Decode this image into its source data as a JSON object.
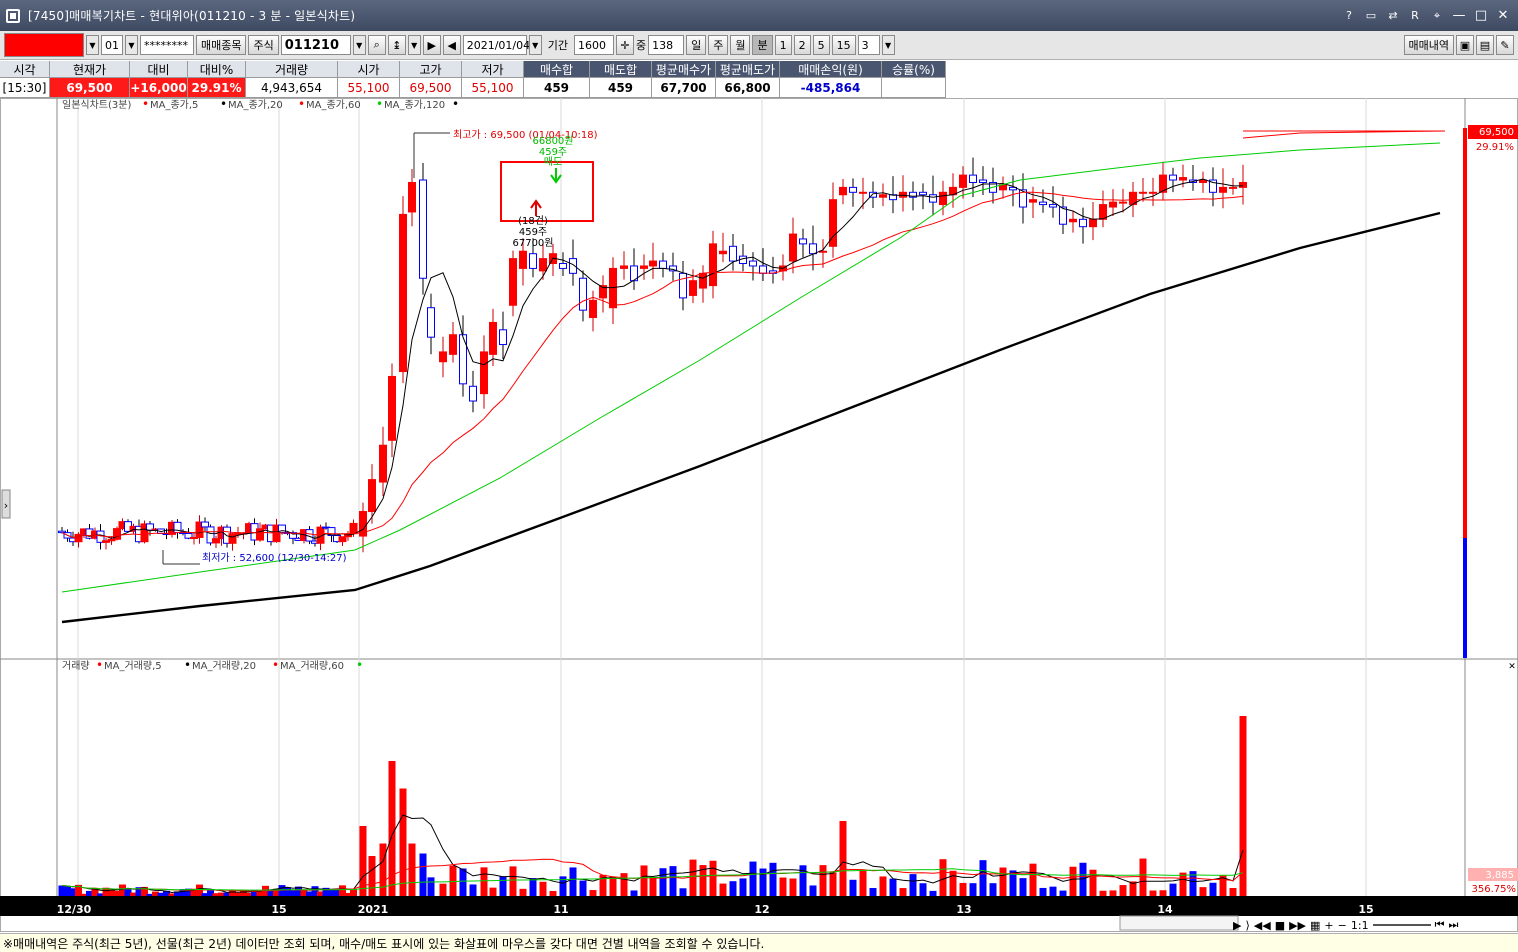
{
  "window": {
    "title": "[7450]매매복기차트 - 현대위아(011210 - 3 분 - 일본식차트)",
    "controls": {
      "help": "?",
      "restore_r": "R",
      "minimize": "—",
      "maximize": "□",
      "close": "✕"
    }
  },
  "toolbar": {
    "account_suffix": "01",
    "password": "********",
    "trade_items_btn": "매매종목",
    "stock_type": "주식",
    "stock_code": "011210",
    "date": "2021/01/04",
    "period_label": "기간",
    "period_value": "1600",
    "middle_label": "중",
    "middle_value": "138",
    "day": "일",
    "week": "주",
    "month": "월",
    "minute": "분",
    "n1": "1",
    "n2": "2",
    "n5": "5",
    "n15": "15",
    "interval": "3",
    "trade_history_btn": "매매내역"
  },
  "quote": {
    "headers": [
      "시각",
      "현재가",
      "대비",
      "대비%",
      "거래량",
      "시가",
      "고가",
      "저가",
      "매수합",
      "매도합",
      "평균매수가",
      "평균매도가",
      "매매손익(원)",
      "승률(%)"
    ],
    "values": [
      "[15:30]",
      "69,500",
      "+16,000",
      "29.91%",
      "4,943,654",
      "55,100",
      "69,500",
      "55,100",
      "459",
      "459",
      "67,700",
      "66,800",
      "-485,864",
      ""
    ]
  },
  "chart": {
    "price_legend": {
      "name": "일본식차트(3분)",
      "ma5": "MA_종가,5",
      "ma20": "MA_종가,20",
      "ma60": "MA_종가,60",
      "ma120": "MA_종가,120"
    },
    "volume_legend": {
      "name": "거래량",
      "ma5": "MA_거래량,5",
      "ma20": "MA_거래량,20",
      "ma60": "MA_거래량,60"
    },
    "annotations": {
      "high": "최고가 : 69,500 (01/04-10:18)",
      "low": "최저가 : 52,600 (12/30-14:27)",
      "sell_price": "66800원",
      "sell_qty": "459주",
      "sell_label": "매도",
      "buy_count": "(18건)",
      "buy_qty": "459주",
      "buy_price": "67700원"
    },
    "right_axis": {
      "price": "69,500",
      "pct": "29.91%",
      "volume": "3,885",
      "volume_pct": "356.75%"
    },
    "x_labels": [
      "12/30",
      "15",
      "2021",
      "11",
      "12",
      "13",
      "14",
      "15"
    ],
    "colors": {
      "up": "#ff0000",
      "down": "#0000ff",
      "ma5": "#000000",
      "ma20": "#ff0000",
      "ma60": "#00cc00",
      "ma120": "#000000",
      "box": "#ff0000"
    }
  },
  "bottom_nav": {
    "zoom": "1:1"
  },
  "status": {
    "message": "※매매내역은 주식(최근 5년), 선물(최근 2년) 데이터만 조회 되며, 매수/매도 표시에 있는 화살표에 마우스를 갖다 대면 건별 내역을 조회할 수 있습니다."
  }
}
